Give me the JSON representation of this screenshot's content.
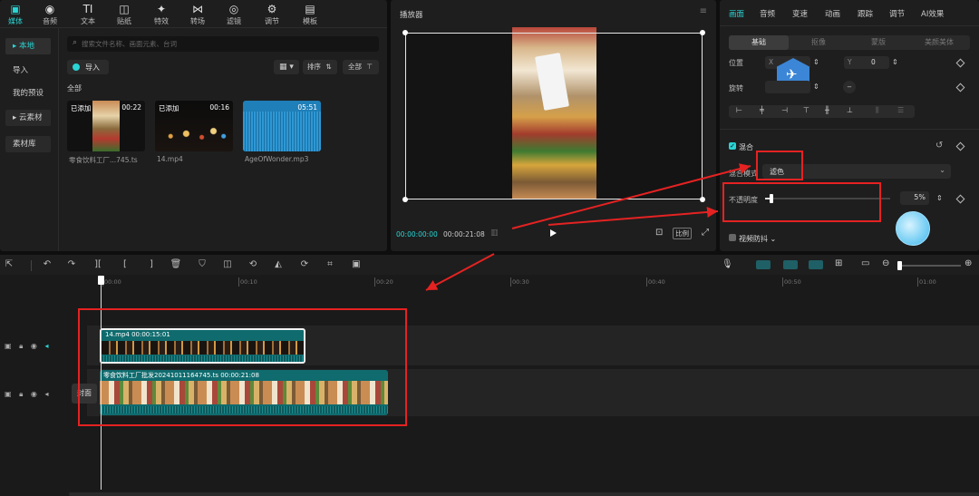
{
  "top_toolbar": [
    {
      "icon": "media-icon",
      "label": "媒体",
      "glyph": "▣",
      "active": true
    },
    {
      "icon": "audio-icon",
      "label": "音频",
      "glyph": "◉",
      "active": false
    },
    {
      "icon": "text-icon",
      "label": "文本",
      "glyph": "TI",
      "active": false
    },
    {
      "icon": "sticker-icon",
      "label": "贴纸",
      "glyph": "◫",
      "active": false
    },
    {
      "icon": "effects-icon",
      "label": "特效",
      "glyph": "✦",
      "active": false
    },
    {
      "icon": "transition-icon",
      "label": "转场",
      "glyph": "⋈",
      "active": false
    },
    {
      "icon": "filter-icon",
      "label": "滤镜",
      "glyph": "◎",
      "active": false
    },
    {
      "icon": "adjust-icon",
      "label": "调节",
      "glyph": "⚙",
      "active": false
    },
    {
      "icon": "template-icon",
      "label": "模板",
      "glyph": "▤",
      "active": false
    }
  ],
  "sidebar": {
    "local": "▸ 本地",
    "import": "导入",
    "presets": "我的预设",
    "cloud": "▸ 云素材",
    "library": "素材库"
  },
  "media": {
    "search_placeholder": "搜索文件名称、画面元素、台词",
    "import_label": "导入",
    "sort_label": "排序",
    "all_filter_label": "全部",
    "section_label": "全部",
    "items": [
      {
        "badge": "已添加",
        "duration": "00:22",
        "caption": "零食饮料工厂...745.ts"
      },
      {
        "badge": "已添加",
        "duration": "00:16",
        "caption": "14.mp4"
      },
      {
        "badge": "",
        "duration": "05:51",
        "caption": "AgeOfWonder.mp3"
      }
    ]
  },
  "player": {
    "title": "播放器",
    "current_time": "00:00:00:00",
    "total_time": "00:00:21:08",
    "ratio_label": "比例"
  },
  "inspector": {
    "tabs": [
      "画面",
      "音频",
      "变速",
      "动画",
      "跟踪",
      "调节",
      "AI效果"
    ],
    "subtabs": [
      "基础",
      "抠像",
      "蒙版",
      "美颜美体"
    ],
    "position_label": "位置",
    "x_label": "X",
    "y_label": "Y",
    "y_value": "0",
    "rotate_label": "旋转",
    "blend_label": "混合",
    "blend_mode_label": "混合模式",
    "blend_mode_value": "滤色",
    "opacity_label": "不透明度",
    "opacity_value": "5%",
    "opacity_level": 0.05,
    "stabilize_label": "视频防抖"
  },
  "timeline": {
    "ruler": [
      "00:00",
      "00:10",
      "00:20",
      "00:30",
      "00:40",
      "00:50",
      "01:00"
    ],
    "clip1_label": "14.mp4   00:00:15:01",
    "clip2_label": "零食饮料工厂批发20241011164745.ts   00:00:21:08",
    "cover_label": "封面"
  },
  "colors": {
    "accent": "#2ad4d4",
    "annotation_red": "#e52222",
    "clip_teal": "#0f6b6e"
  }
}
